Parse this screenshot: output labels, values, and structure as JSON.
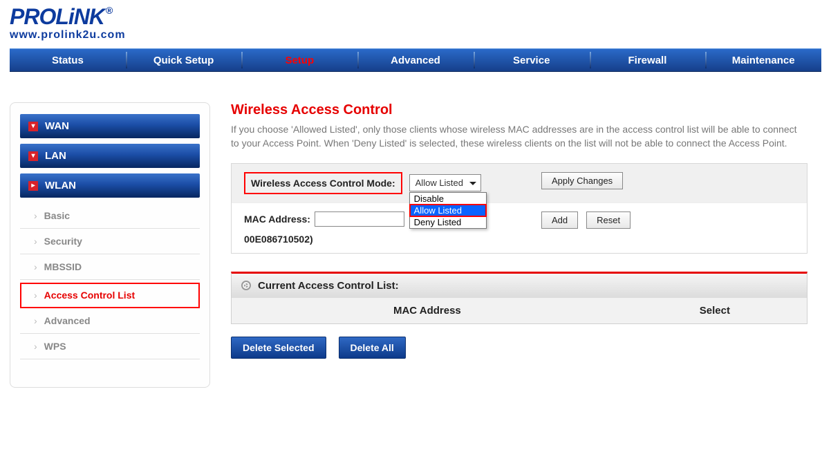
{
  "brand": {
    "name": "PROLiNK",
    "reg": "®",
    "url": "www.prolink2u.com"
  },
  "topnav": {
    "items": [
      "Status",
      "Quick Setup",
      "Setup",
      "Advanced",
      "Service",
      "Firewall",
      "Maintenance"
    ],
    "active_index": 2
  },
  "sidebar": {
    "categories": [
      {
        "label": "WAN",
        "expanded": false
      },
      {
        "label": "LAN",
        "expanded": false
      },
      {
        "label": "WLAN",
        "expanded": true
      }
    ],
    "wlan_items": [
      "Basic",
      "Security",
      "MBSSID",
      "Access Control List",
      "Advanced",
      "WPS"
    ],
    "active_wlan_index": 3
  },
  "page": {
    "title": "Wireless Access Control",
    "description": "If you choose 'Allowed Listed', only those clients whose wireless MAC addresses are in the access control list will be able to connect to your Access Point. When 'Deny Listed' is selected, these wireless clients on the list will not be able to connect the Access Point."
  },
  "form": {
    "mode_label": "Wireless Access Control Mode:",
    "mode_value": "Allow Listed",
    "mode_options": [
      "Disable",
      "Allow Listed",
      "Deny Listed"
    ],
    "apply_label": "Apply Changes",
    "mac_label": "MAC Address:",
    "mac_value": "",
    "mac_hint": "00E086710502)",
    "add_label": "Add",
    "reset_label": "Reset"
  },
  "list": {
    "header": "Current Access Control List:",
    "columns": [
      "MAC Address",
      "Select"
    ]
  },
  "actions": {
    "delete_selected": "Delete Selected",
    "delete_all": "Delete All"
  }
}
